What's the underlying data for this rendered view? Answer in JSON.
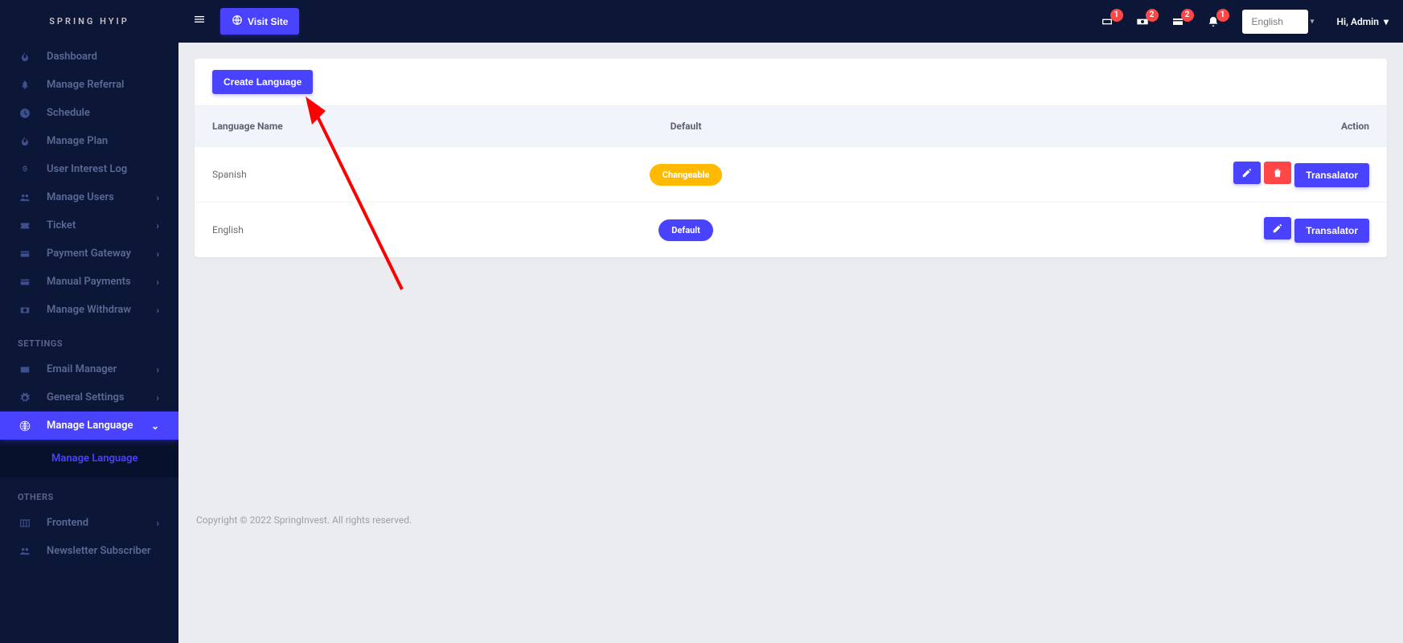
{
  "brand": "SPRING HYIP",
  "sidebar": {
    "main": [
      {
        "label": "Dashboard"
      },
      {
        "label": "Manage Referral"
      },
      {
        "label": "Schedule"
      },
      {
        "label": "Manage Plan"
      },
      {
        "label": "User Interest Log"
      },
      {
        "label": "Manage Users"
      },
      {
        "label": "Ticket"
      },
      {
        "label": "Payment Gateway"
      },
      {
        "label": "Manual Payments"
      },
      {
        "label": "Manage Withdraw"
      }
    ],
    "settings_header": "SETTINGS",
    "settings": [
      {
        "label": "Email Manager"
      },
      {
        "label": "General Settings"
      },
      {
        "label": "Manage Language",
        "sub": [
          {
            "label": "Manage Language"
          }
        ]
      }
    ],
    "others_header": "OTHERS",
    "others": [
      {
        "label": "Frontend"
      },
      {
        "label": "Newsletter Subscriber"
      }
    ]
  },
  "topbar": {
    "visit_site": "Visit Site",
    "badge1": "1",
    "badge2": "2",
    "badge3": "2",
    "badge4": "1",
    "language_selected": "English",
    "user_label": "Hi, Admin"
  },
  "page": {
    "create_btn": "Create Language",
    "headers": {
      "name": "Language Name",
      "default": "Default",
      "action": "Action"
    },
    "rows": [
      {
        "name": "Spanish",
        "default_badge": "Changeable",
        "default_class": "badge-yellow",
        "deletable": true,
        "translator": "Transalator"
      },
      {
        "name": "English",
        "default_badge": "Default",
        "default_class": "badge-blue",
        "deletable": false,
        "translator": "Transalator"
      }
    ]
  },
  "footer": "Copyright © 2022 SpringInvest. All rights reserved."
}
